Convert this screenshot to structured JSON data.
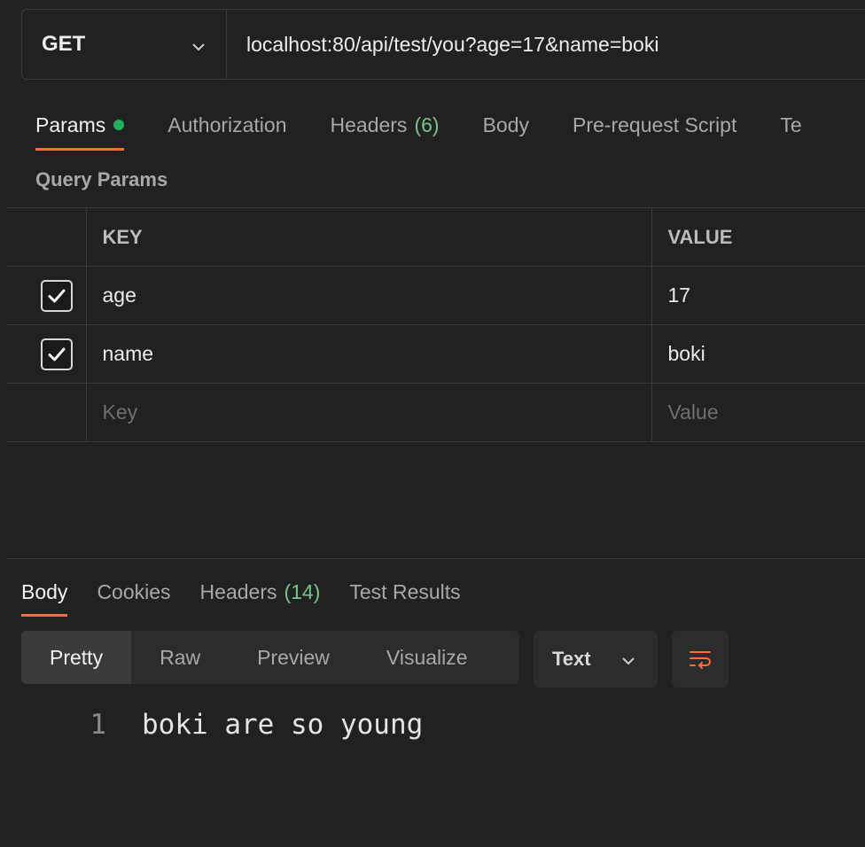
{
  "request": {
    "method": "GET",
    "url": "localhost:80/api/test/you?age=17&name=boki"
  },
  "request_tabs": [
    {
      "label": "Params",
      "active": true,
      "dot": true
    },
    {
      "label": "Authorization"
    },
    {
      "label": "Headers",
      "count": "(6)"
    },
    {
      "label": "Body"
    },
    {
      "label": "Pre-request Script"
    },
    {
      "label": "Te"
    }
  ],
  "query_params": {
    "title": "Query Params",
    "headers": {
      "key": "KEY",
      "value": "VALUE"
    },
    "rows": [
      {
        "key": "age",
        "value": "17",
        "checked": true
      },
      {
        "key": "name",
        "value": "boki",
        "checked": true
      }
    ],
    "placeholder": {
      "key": "Key",
      "value": "Value"
    }
  },
  "response_tabs": [
    {
      "label": "Body",
      "active": true
    },
    {
      "label": "Cookies"
    },
    {
      "label": "Headers",
      "count": "(14)"
    },
    {
      "label": "Test Results"
    }
  ],
  "view_modes": [
    {
      "label": "Pretty",
      "active": true
    },
    {
      "label": "Raw"
    },
    {
      "label": "Preview"
    },
    {
      "label": "Visualize"
    }
  ],
  "format": {
    "selected": "Text"
  },
  "response_body": {
    "lines": [
      {
        "number": "1",
        "text": "boki are so young"
      }
    ]
  },
  "colors": {
    "accent": "#ff6c37",
    "success": "#23b05a",
    "count_green": "#74c48d",
    "background": "#212121"
  },
  "icons": {
    "method_dropdown": "chevron-down-icon",
    "format_dropdown": "chevron-down-icon",
    "wrap": "wrap-lines-icon",
    "checkbox": "check-icon"
  }
}
